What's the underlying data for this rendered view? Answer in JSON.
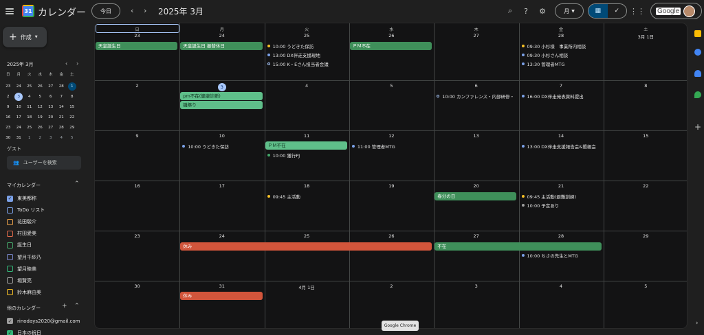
{
  "header": {
    "app_name": "カレンダー",
    "today_label": "今日",
    "month_title": "2025年 3月",
    "view_label": "月",
    "account_text": "Google"
  },
  "sidebar": {
    "create_label": "作成",
    "mini_title": "2025年 3月",
    "mini_weekdays": [
      "日",
      "月",
      "火",
      "水",
      "木",
      "金",
      "土"
    ],
    "mini_weeks": [
      [
        "23",
        "24",
        "25",
        "26",
        "27",
        "28",
        "1"
      ],
      [
        "2",
        "3",
        "4",
        "5",
        "6",
        "7",
        "8"
      ],
      [
        "9",
        "10",
        "11",
        "12",
        "13",
        "14",
        "15"
      ],
      [
        "16",
        "17",
        "18",
        "19",
        "20",
        "21",
        "22"
      ],
      [
        "23",
        "24",
        "25",
        "26",
        "27",
        "28",
        "29"
      ],
      [
        "30",
        "31",
        "1",
        "2",
        "3",
        "4",
        "5"
      ]
    ],
    "guest_label": "ゲスト",
    "guest_search_placeholder": "ユーザーを検索",
    "my_calendars_title": "マイカレンダー",
    "my_calendars": [
      {
        "name": "東美都称",
        "color": "#7ba1e8",
        "checked": true
      },
      {
        "name": "ToDo リスト",
        "color": "#7ba1e8",
        "checked": false
      },
      {
        "name": "花田駿介",
        "color": "#e8a04a",
        "checked": false
      },
      {
        "name": "村田愛美",
        "color": "#e06a4a",
        "checked": false
      },
      {
        "name": "誕生日",
        "color": "#44a66a",
        "checked": false
      },
      {
        "name": "望月千紗乃",
        "color": "#7986cb",
        "checked": false
      },
      {
        "name": "望月睦美",
        "color": "#33b679",
        "checked": false
      },
      {
        "name": "堀賢亮",
        "color": "#9e9e9e",
        "checked": false
      },
      {
        "name": "鈴木麻由美",
        "color": "#f6bf26",
        "checked": false
      }
    ],
    "other_calendars_title": "他のカレンダー",
    "other_calendars": [
      {
        "name": "rinodays2020@gmail.com",
        "color": "#9e9e9e",
        "checked": true
      },
      {
        "name": "日本の祝日",
        "color": "#33b679",
        "checked": true
      }
    ]
  },
  "grid": {
    "weekdays": [
      "日",
      "月",
      "火",
      "水",
      "木",
      "金",
      "土"
    ],
    "weeks": [
      [
        "23",
        "24",
        "25",
        "26",
        "27",
        "28",
        "3月 1日"
      ],
      [
        "2",
        "3",
        "4",
        "5",
        "6",
        "7",
        "8"
      ],
      [
        "9",
        "10",
        "11",
        "12",
        "13",
        "14",
        "15"
      ],
      [
        "16",
        "17",
        "18",
        "19",
        "20",
        "21",
        "22"
      ],
      [
        "23",
        "24",
        "25",
        "26",
        "27",
        "28",
        "29"
      ],
      [
        "30",
        "31",
        "4月 1日",
        "2",
        "3",
        "4",
        "5"
      ]
    ],
    "today_label": "3"
  },
  "events": {
    "w0_sun": "天皇誕生日",
    "w0_mon": "天皇誕生日 振替休日",
    "w0_tue_1": "10:00 うどきた保訪",
    "w0_tue_2": "13:00 DX伴走支援現地",
    "w0_tue_3": "15:00 K・Eさん担当者会議",
    "w0_wed": "ＰＭ不在",
    "w0_fri_1": "09:30 小杉様　事業所内相談",
    "w0_fri_2": "09:30 小杉さん相談",
    "w0_fri_3": "13:30 管理者MTG",
    "w1_mon_1": "pm不在(健康診断)",
    "w1_mon_2": "雛祭り",
    "w1_thu": "10:00 カンファレンス・内部研修・",
    "w1_fri": "16:00 DX伴走発表資料提出",
    "w2_mon": "10:00 うどきた保訪",
    "w2_tue_1": "ＰＭ不在",
    "w2_tue_2": "10:00 獲行PJ",
    "w2_wed": "11:00 管理者MTG",
    "w2_fri": "13:00 DX伴走支援報告会&懇親会",
    "w3_tue": "09:45 主活動",
    "w3_thu": "春分の日",
    "w3_fri_1": "09:45 主活動(避難訓練)",
    "w3_fri_2": "10:00 予定あり",
    "w4_rest": "休み",
    "w4_absent": "不在",
    "w4_fri": "10:00 ちさの先生とMTG",
    "w5_mon": "休み"
  },
  "tooltip": "Google Chrome"
}
